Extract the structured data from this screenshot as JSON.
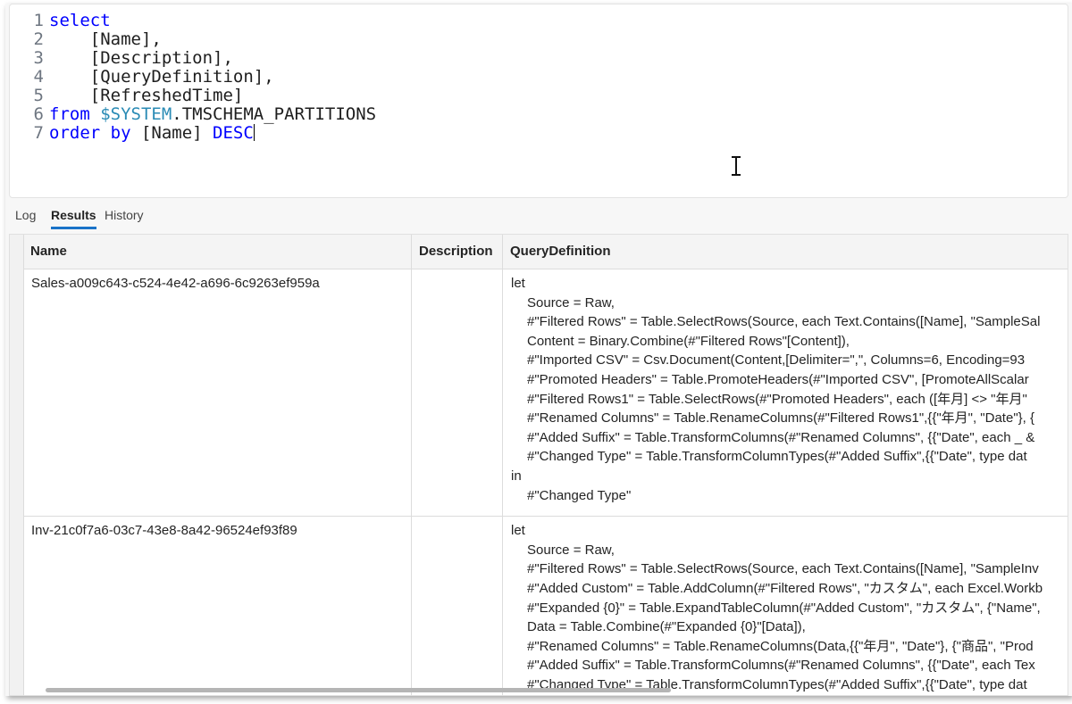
{
  "editor": {
    "lines": [
      {
        "num": "1",
        "indent": "",
        "kw": "select",
        "text": ""
      },
      {
        "num": "2",
        "indent": "    ",
        "kw": "",
        "text": "[Name],"
      },
      {
        "num": "3",
        "indent": "    ",
        "kw": "",
        "text": "[Description],"
      },
      {
        "num": "4",
        "indent": "    ",
        "kw": "",
        "text": "[QueryDefinition],"
      },
      {
        "num": "5",
        "indent": "    ",
        "kw": "",
        "text": "[RefreshedTime]"
      }
    ],
    "line6": {
      "num": "6",
      "kw": "from",
      "var": "$SYSTEM",
      "rest": ".TMSCHEMA_PARTITIONS"
    },
    "line7": {
      "num": "7",
      "kw": "order by",
      "mid": " [Name] ",
      "kw2": "DESC"
    }
  },
  "tabs": [
    {
      "label": "Log",
      "active": false
    },
    {
      "label": "Results",
      "active": true
    },
    {
      "label": "History",
      "active": false
    }
  ],
  "results": {
    "columns": [
      "Name",
      "Description",
      "QueryDefinition"
    ],
    "rows": [
      {
        "name": "Sales-a009c643-c524-4e42-a696-6c9263ef959a",
        "description": "",
        "query": [
          "let",
          "Source = Raw,",
          "#\"Filtered Rows\" = Table.SelectRows(Source, each Text.Contains([Name], \"SampleSal",
          "Content = Binary.Combine(#\"Filtered Rows\"[Content]),",
          "#\"Imported CSV\" = Csv.Document(Content,[Delimiter=\",\", Columns=6, Encoding=93",
          "#\"Promoted Headers\" = Table.PromoteHeaders(#\"Imported CSV\", [PromoteAllScalar",
          "#\"Filtered Rows1\" = Table.SelectRows(#\"Promoted Headers\", each ([年月] <> \"年月\"",
          "#\"Renamed Columns\" = Table.RenameColumns(#\"Filtered Rows1\",{{\"年月\", \"Date\"}, {",
          "#\"Added Suffix\" = Table.TransformColumns(#\"Renamed Columns\", {{\"Date\", each _ &",
          "#\"Changed Type\" = Table.TransformColumnTypes(#\"Added Suffix\",{{\"Date\", type dat",
          "in",
          "#\"Changed Type\""
        ]
      },
      {
        "name": "Inv-21c0f7a6-03c7-43e8-8a42-96524ef93f89",
        "description": "",
        "query": [
          "let",
          "Source = Raw,",
          "#\"Filtered Rows\" = Table.SelectRows(Source, each Text.Contains([Name], \"SampleInv",
          "#\"Added Custom\" = Table.AddColumn(#\"Filtered Rows\", \"カスタム\", each Excel.Workb",
          "#\"Expanded {0}\" = Table.ExpandTableColumn(#\"Added Custom\", \"カスタム\", {\"Name\",",
          "Data = Table.Combine(#\"Expanded {0}\"[Data]),",
          "#\"Renamed Columns\" = Table.RenameColumns(Data,{{\"年月\", \"Date\"}, {\"商品\", \"Prod",
          "#\"Added Suffix\" = Table.TransformColumns(#\"Renamed Columns\", {{\"Date\", each Tex",
          "#\"Changed Type\" = Table.TransformColumnTypes(#\"Added Suffix\",{{\"Date\", type dat"
        ]
      }
    ]
  }
}
